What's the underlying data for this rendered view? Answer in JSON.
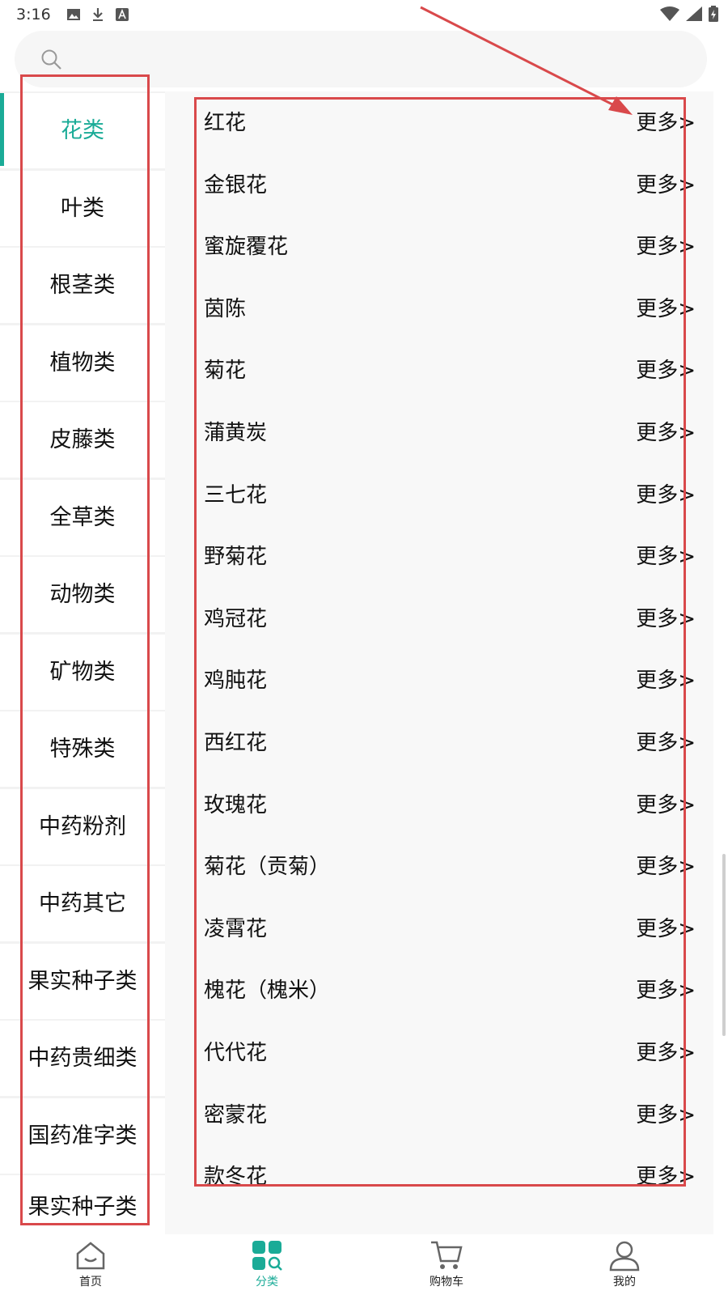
{
  "status_bar": {
    "time": "3:16"
  },
  "search": {
    "placeholder": ""
  },
  "sidebar": {
    "items": [
      {
        "label": "花类",
        "active": true
      },
      {
        "label": "叶类"
      },
      {
        "label": "根茎类"
      },
      {
        "label": "植物类"
      },
      {
        "label": "皮藤类"
      },
      {
        "label": "全草类"
      },
      {
        "label": "动物类"
      },
      {
        "label": "矿物类"
      },
      {
        "label": "特殊类"
      },
      {
        "label": "中药粉剂"
      },
      {
        "label": "中药其它"
      },
      {
        "label": "果实种子类"
      },
      {
        "label": "中药贵细类"
      },
      {
        "label": "国药准字类"
      },
      {
        "label": "果实种子类"
      }
    ]
  },
  "main": {
    "more_label": "更多>",
    "items": [
      "红花",
      "金银花",
      "蜜旋覆花",
      "茵陈",
      "菊花",
      "蒲黄炭",
      "三七花",
      "野菊花",
      "鸡冠花",
      "鸡肫花",
      "西红花",
      "玫瑰花",
      "菊花（贡菊）",
      "凌霄花",
      "槐花（槐米）",
      "代代花",
      "密蒙花",
      "款冬花"
    ]
  },
  "bottom_nav": {
    "items": [
      {
        "label": "首页",
        "icon": "home-icon"
      },
      {
        "label": "分类",
        "icon": "category-icon",
        "active": true
      },
      {
        "label": "购物车",
        "icon": "cart-icon"
      },
      {
        "label": "我的",
        "icon": "user-icon"
      }
    ]
  },
  "colors": {
    "accent": "#1aab97",
    "annotation": "#d9494b"
  }
}
